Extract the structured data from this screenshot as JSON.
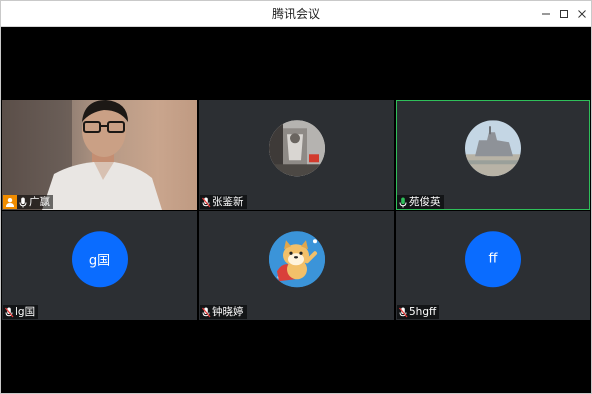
{
  "window": {
    "title": "腾讯会议",
    "controls": {
      "minimize": "minimize-icon",
      "maximize": "maximize-icon",
      "close": "close-icon"
    }
  },
  "participants": [
    {
      "name": "广赢",
      "mic": "on",
      "host": true,
      "view": "camera"
    },
    {
      "name": "张鉴新",
      "mic": "muted",
      "view": "photo-avatar"
    },
    {
      "name": "苑俊英",
      "mic": "active",
      "view": "photo-avatar",
      "speaking": true
    },
    {
      "name": "lg国",
      "mic": "muted",
      "view": "letter-avatar",
      "avatar_text": "g国"
    },
    {
      "name": "钟晓婷",
      "mic": "muted",
      "view": "cartoon-avatar"
    },
    {
      "name": "5hgff",
      "mic": "muted",
      "view": "letter-avatar",
      "avatar_text": "ff"
    }
  ],
  "colors": {
    "tile_bg": "#2c2f33",
    "avatar_blue": "#0a6cff",
    "speaking_border": "#2fbf5a",
    "host_badge": "#f08c00",
    "mic_muted": "#e33b3b",
    "mic_active": "#2fbf5a"
  }
}
